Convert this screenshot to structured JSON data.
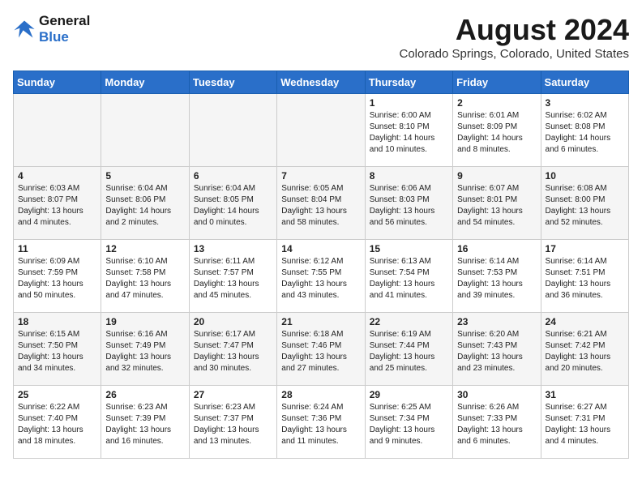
{
  "header": {
    "logo_line1": "General",
    "logo_line2": "Blue",
    "month_year": "August 2024",
    "location": "Colorado Springs, Colorado, United States"
  },
  "weekdays": [
    "Sunday",
    "Monday",
    "Tuesday",
    "Wednesday",
    "Thursday",
    "Friday",
    "Saturday"
  ],
  "weeks": [
    [
      {
        "day": "",
        "sunrise": "",
        "sunset": "",
        "daylight": ""
      },
      {
        "day": "",
        "sunrise": "",
        "sunset": "",
        "daylight": ""
      },
      {
        "day": "",
        "sunrise": "",
        "sunset": "",
        "daylight": ""
      },
      {
        "day": "",
        "sunrise": "",
        "sunset": "",
        "daylight": ""
      },
      {
        "day": "1",
        "sunrise": "6:00 AM",
        "sunset": "8:10 PM",
        "daylight": "14 hours and 10 minutes."
      },
      {
        "day": "2",
        "sunrise": "6:01 AM",
        "sunset": "8:09 PM",
        "daylight": "14 hours and 8 minutes."
      },
      {
        "day": "3",
        "sunrise": "6:02 AM",
        "sunset": "8:08 PM",
        "daylight": "14 hours and 6 minutes."
      }
    ],
    [
      {
        "day": "4",
        "sunrise": "6:03 AM",
        "sunset": "8:07 PM",
        "daylight": "13 hours and 4 minutes."
      },
      {
        "day": "5",
        "sunrise": "6:04 AM",
        "sunset": "8:06 PM",
        "daylight": "14 hours and 2 minutes."
      },
      {
        "day": "6",
        "sunrise": "6:04 AM",
        "sunset": "8:05 PM",
        "daylight": "14 hours and 0 minutes."
      },
      {
        "day": "7",
        "sunrise": "6:05 AM",
        "sunset": "8:04 PM",
        "daylight": "13 hours and 58 minutes."
      },
      {
        "day": "8",
        "sunrise": "6:06 AM",
        "sunset": "8:03 PM",
        "daylight": "13 hours and 56 minutes."
      },
      {
        "day": "9",
        "sunrise": "6:07 AM",
        "sunset": "8:01 PM",
        "daylight": "13 hours and 54 minutes."
      },
      {
        "day": "10",
        "sunrise": "6:08 AM",
        "sunset": "8:00 PM",
        "daylight": "13 hours and 52 minutes."
      }
    ],
    [
      {
        "day": "11",
        "sunrise": "6:09 AM",
        "sunset": "7:59 PM",
        "daylight": "13 hours and 50 minutes."
      },
      {
        "day": "12",
        "sunrise": "6:10 AM",
        "sunset": "7:58 PM",
        "daylight": "13 hours and 47 minutes."
      },
      {
        "day": "13",
        "sunrise": "6:11 AM",
        "sunset": "7:57 PM",
        "daylight": "13 hours and 45 minutes."
      },
      {
        "day": "14",
        "sunrise": "6:12 AM",
        "sunset": "7:55 PM",
        "daylight": "13 hours and 43 minutes."
      },
      {
        "day": "15",
        "sunrise": "6:13 AM",
        "sunset": "7:54 PM",
        "daylight": "13 hours and 41 minutes."
      },
      {
        "day": "16",
        "sunrise": "6:14 AM",
        "sunset": "7:53 PM",
        "daylight": "13 hours and 39 minutes."
      },
      {
        "day": "17",
        "sunrise": "6:14 AM",
        "sunset": "7:51 PM",
        "daylight": "13 hours and 36 minutes."
      }
    ],
    [
      {
        "day": "18",
        "sunrise": "6:15 AM",
        "sunset": "7:50 PM",
        "daylight": "13 hours and 34 minutes."
      },
      {
        "day": "19",
        "sunrise": "6:16 AM",
        "sunset": "7:49 PM",
        "daylight": "13 hours and 32 minutes."
      },
      {
        "day": "20",
        "sunrise": "6:17 AM",
        "sunset": "7:47 PM",
        "daylight": "13 hours and 30 minutes."
      },
      {
        "day": "21",
        "sunrise": "6:18 AM",
        "sunset": "7:46 PM",
        "daylight": "13 hours and 27 minutes."
      },
      {
        "day": "22",
        "sunrise": "6:19 AM",
        "sunset": "7:44 PM",
        "daylight": "13 hours and 25 minutes."
      },
      {
        "day": "23",
        "sunrise": "6:20 AM",
        "sunset": "7:43 PM",
        "daylight": "13 hours and 23 minutes."
      },
      {
        "day": "24",
        "sunrise": "6:21 AM",
        "sunset": "7:42 PM",
        "daylight": "13 hours and 20 minutes."
      }
    ],
    [
      {
        "day": "25",
        "sunrise": "6:22 AM",
        "sunset": "7:40 PM",
        "daylight": "13 hours and 18 minutes."
      },
      {
        "day": "26",
        "sunrise": "6:23 AM",
        "sunset": "7:39 PM",
        "daylight": "13 hours and 16 minutes."
      },
      {
        "day": "27",
        "sunrise": "6:23 AM",
        "sunset": "7:37 PM",
        "daylight": "13 hours and 13 minutes."
      },
      {
        "day": "28",
        "sunrise": "6:24 AM",
        "sunset": "7:36 PM",
        "daylight": "13 hours and 11 minutes."
      },
      {
        "day": "29",
        "sunrise": "6:25 AM",
        "sunset": "7:34 PM",
        "daylight": "13 hours and 9 minutes."
      },
      {
        "day": "30",
        "sunrise": "6:26 AM",
        "sunset": "7:33 PM",
        "daylight": "13 hours and 6 minutes."
      },
      {
        "day": "31",
        "sunrise": "6:27 AM",
        "sunset": "7:31 PM",
        "daylight": "13 hours and 4 minutes."
      }
    ]
  ]
}
